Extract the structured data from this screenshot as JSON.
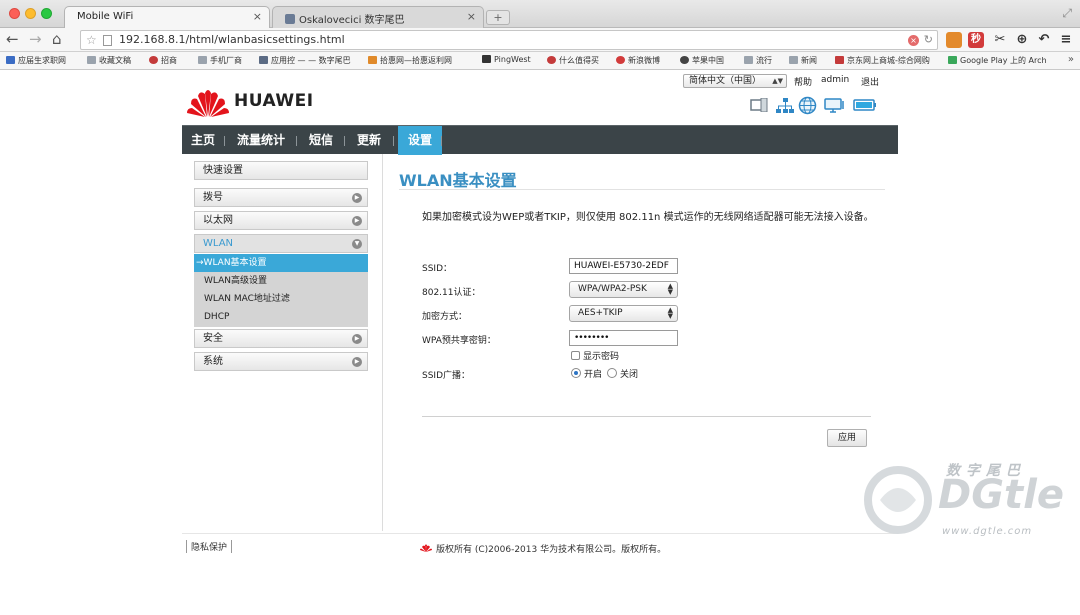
{
  "browser": {
    "tabs": [
      {
        "title": "Mobile WiFi",
        "active": true
      },
      {
        "title": "Oskalovecici 数字尾巴",
        "active": false
      }
    ],
    "url": "192.168.8.1/html/wlanbasicsettings.html",
    "extension_labels": {
      "blue_mini": "秒"
    },
    "bookmarks": [
      "应届生求职网",
      "收藏文稿",
      "招商",
      "手机厂商",
      "应用控 — — 数字尾巴",
      "拾惠网—拾惠返利网",
      "PingWest",
      "什么值得买",
      "新浪微博",
      "苹果中国",
      "流行",
      "新闻",
      "京东网上商城-综合网购",
      "Google Play 上的 Arch"
    ]
  },
  "header": {
    "language": "简体中文（中国）",
    "help": "帮助",
    "user": "admin",
    "logout": "退出",
    "brand": "HUAWEI"
  },
  "nav": {
    "items": [
      "主页",
      "流量统计",
      "短信",
      "更新",
      "设置"
    ],
    "active_index": 4
  },
  "sidebar": {
    "items": [
      "快速设置",
      "拨号",
      "以太网",
      "WLAN",
      "安全",
      "系统"
    ],
    "wlan_sub": [
      "→WLAN基本设置",
      "WLAN高级设置",
      "WLAN MAC地址过滤",
      "DHCP"
    ]
  },
  "content": {
    "title": "WLAN基本设置",
    "notice": "如果加密模式设为WEP或者TKIP，则仅使用 802.11n 模式运作的无线网络适配器可能无法接入设备。",
    "ssid_label": "SSID：",
    "ssid_value": "HUAWEI-E5730-2EDF",
    "auth_label": "802.11认证：",
    "auth_value": "WPA/WPA2-PSK",
    "enc_label": "加密方式：",
    "enc_value": "AES+TKIP",
    "psk_label": "WPA预共享密钥：",
    "psk_value": "••••••••",
    "show_password": "显示密码",
    "broadcast_label": "SSID广播：",
    "broadcast_on": "开启",
    "broadcast_off": "关闭",
    "apply": "应用"
  },
  "footer": {
    "privacy": "隐私保护",
    "copyright": "版权所有 (C)2006-2013 华为技术有限公司。版权所有。"
  },
  "watermark": {
    "cn": "数字尾巴",
    "brand": "DGtle",
    "url": "www.dgtle.com"
  },
  "colors": {
    "nav_bg": "#3b4448",
    "accent": "#3aa8d8",
    "title": "#3a8fc2"
  }
}
